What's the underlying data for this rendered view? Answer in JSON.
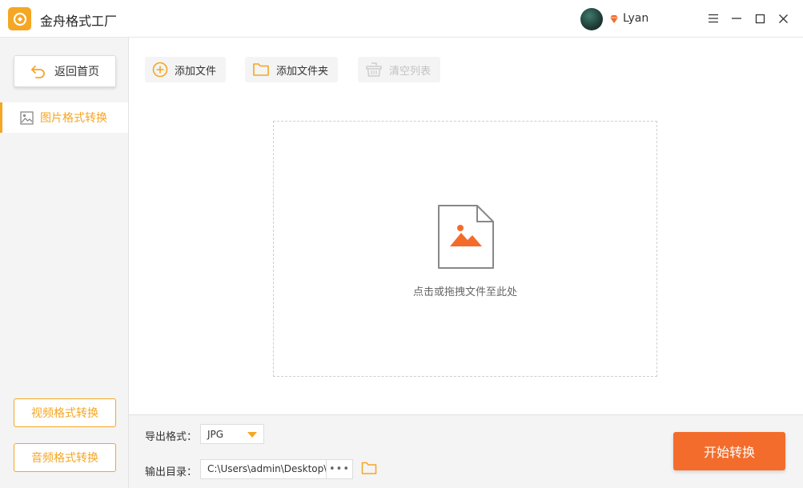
{
  "app": {
    "title": "金舟格式工厂"
  },
  "user": {
    "name": "Lyan"
  },
  "sidebar": {
    "home_label": "返回首页",
    "active_item": "图片格式转换",
    "video_label": "视频格式转换",
    "audio_label": "音频格式转换"
  },
  "toolbar": {
    "add_file": "添加文件",
    "add_folder": "添加文件夹",
    "clear_list": "清空列表"
  },
  "dropzone": {
    "hint": "点击或拖拽文件至此处"
  },
  "output": {
    "format_label": "导出格式：",
    "format_value": "JPG",
    "dir_label": "输出目录：",
    "dir_value": "C:\\Users\\admin\\Desktop\\",
    "more_label": "•••"
  },
  "actions": {
    "start_label": "开始转换"
  },
  "colors": {
    "accent": "#f5a623",
    "primary_button": "#f36c2b"
  },
  "icons": [
    "app-logo-icon",
    "vip-diamond-icon",
    "menu-icon",
    "minimize-icon",
    "maximize-icon",
    "close-icon",
    "back-arrow-icon",
    "image-icon",
    "add-circle-icon",
    "folder-icon",
    "basket-icon",
    "image-file-icon"
  ]
}
